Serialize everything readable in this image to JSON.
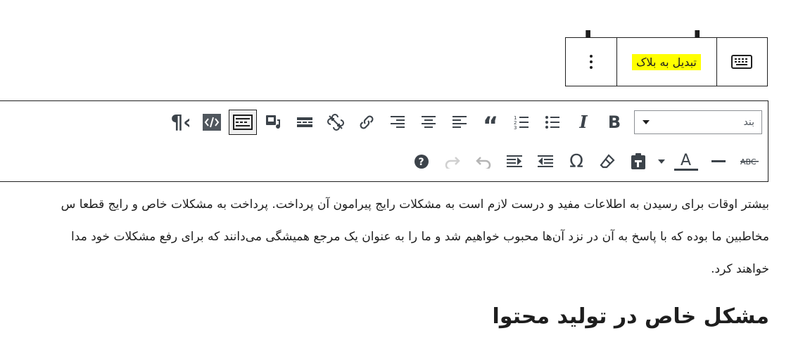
{
  "post": {
    "heading_visible": "در تولید محتوا",
    "paragraph_lines": [
      "بیشتر اوقات برای رسیدن به اطلاعات مفید و درست لازم است به مشکلات رایج پیرامون آن پرداخت. پرداخت به مشکلات خاص و رایج قطعا س",
      "مخاطبین ما بوده که با پاسخ به آن در نزد آن‌ها محبوب خواهیم شد و ما را به عنوان یک مرجع همیشگی می‌دانند که برای رفع مشکلات خود مدا",
      "خواهند کرد."
    ],
    "subheading": "مشکل خاص در تولید محتوا"
  },
  "block_toolbar": {
    "convert_label": "تبدیل به بلاک",
    "more_icon": "more-vertical-icon",
    "keyboard_icon": "keyboard-icon"
  },
  "classic_toolbar": {
    "format_select_value": "بند",
    "row1_icons": [
      "bold-icon",
      "italic-icon",
      "bullet-list-icon",
      "numbered-list-icon",
      "blockquote-icon",
      "align-left-icon",
      "align-center-icon",
      "align-right-icon",
      "link-icon",
      "unlink-icon",
      "read-more-icon",
      "insert-media-icon",
      "toolbar-toggle-icon",
      "code-icon",
      "paragraph-direction-icon"
    ],
    "row2_icons": [
      "strikethrough-icon",
      "horizontal-line-icon",
      "text-color-icon",
      "text-color-dropdown-icon",
      "paste-as-text-icon",
      "clear-formatting-icon",
      "special-character-icon",
      "decrease-indent-icon",
      "increase-indent-icon",
      "undo-icon",
      "redo-icon",
      "help-icon"
    ]
  },
  "colors": {
    "highlight": "#ffff00",
    "border": "#1e1e1e",
    "icon": "#3c434a"
  }
}
